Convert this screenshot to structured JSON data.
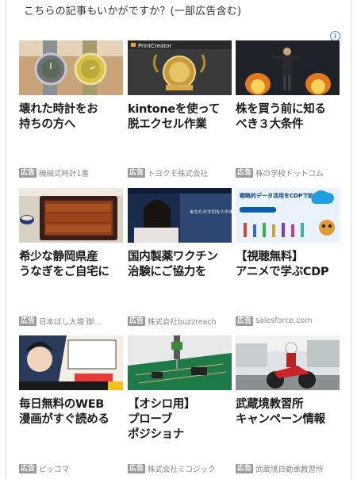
{
  "header": {
    "text": "こちらの記事もいかがですか？(一部広告含む)"
  },
  "adchoices_icon": "info-icon",
  "ad_badge": "広告",
  "cards": [
    {
      "title": "壊れた時計をお\n持ちの方へ",
      "advertiser": "機械式時計1番",
      "image": "two-wristwatches"
    },
    {
      "title": "kintoneを使って\n脱エクセル作業",
      "advertiser": "トヨクモ株式会社",
      "image": "printcreator-award-banner",
      "image_text": "PrintCreator"
    },
    {
      "title": "株を買う前に知る\nべき３大条件",
      "advertiser": "株の学校ドットコム",
      "image": "man-with-jetpack-flames"
    },
    {
      "title": "希少な静岡県産\nうなぎをご自宅に",
      "advertiser": "日本ばし大増 御...",
      "image": "grilled-eel-box"
    },
    {
      "title": "国内製薬ワクチン\n治験にご協力を",
      "advertiser": "株式会社buzzreach",
      "image": "vaccine-trial-woman-banner",
      "image_text": "あなたの大切な人の未来のために。"
    },
    {
      "title": "【視聴無料】\nアニメで学ぶCDP",
      "advertiser": "salesforce.com",
      "image": "salesforce-cdp-banner",
      "image_text": "戦略的データ活用をCDPで始めよう"
    },
    {
      "title": "毎日無料のWEB\n漫画がすぐ読める",
      "advertiser": "ピッコマ",
      "image": "manga-panel"
    },
    {
      "title": "【オシロ用】\nプローブ\nポジショナ",
      "advertiser": "株式会社ミコジック",
      "image": "circuit-board-probe"
    },
    {
      "title": "武蔵境教習所\nキャンペーン情報",
      "advertiser": "武蔵境自動車教習所",
      "image": "motorcycle-rider"
    }
  ]
}
